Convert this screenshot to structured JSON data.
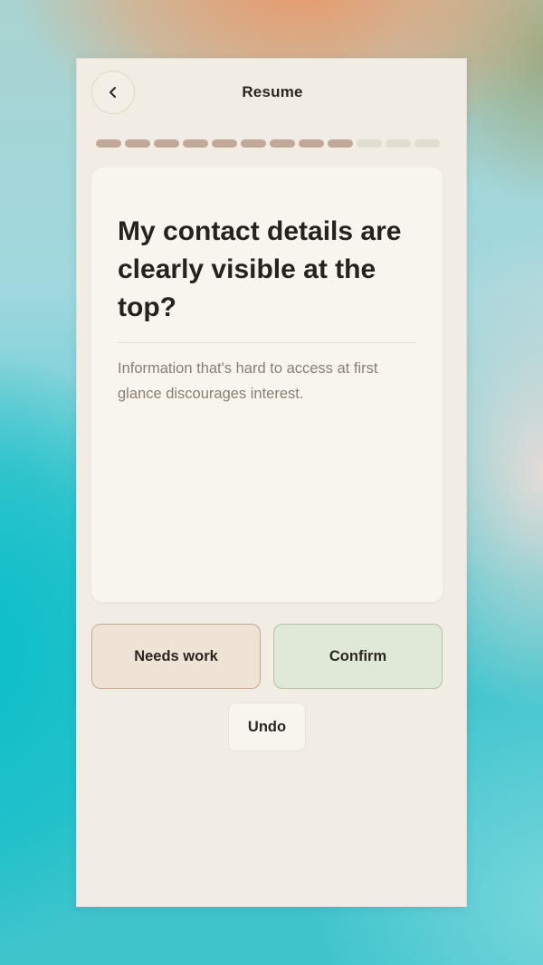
{
  "header": {
    "back_icon": "chevron-left-icon",
    "title": "Resume"
  },
  "progress": {
    "total_steps": 12,
    "completed_steps": 9,
    "colors": {
      "done": "#c2a898",
      "todo": "#e1dbd2"
    }
  },
  "card": {
    "question": "My contact details are clearly visible at the top?",
    "hint": "Information that's hard to access at first glance discourages interest."
  },
  "actions": {
    "needs_work_label": "Needs work",
    "confirm_label": "Confirm",
    "undo_label": "Undo"
  },
  "colors": {
    "needs_work_bg": "#efe3d6",
    "confirm_bg": "#e0e8d8",
    "panel_bg": "#f2ede4"
  }
}
